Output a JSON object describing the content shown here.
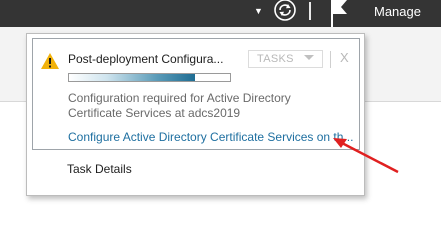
{
  "topbar": {
    "manage_label": "Manage",
    "icons": [
      "chevron-down-icon",
      "refresh-icon",
      "notification-flag-icon"
    ]
  },
  "notification": {
    "title": "Post-deployment Configura...",
    "tasks_label": "TASKS",
    "close_label": "X",
    "progress_fraction": 0.78,
    "message": "Configuration required for Active Directory Certificate Services at adcs2019",
    "link": "Configure Active Directory Certificate Services on th..."
  },
  "footer": {
    "task_details_label": "Task Details"
  },
  "colors": {
    "topbar": "#343434",
    "link": "#1e6fa0",
    "warning": "#f2b20a",
    "progress": "#1f6d93",
    "annotation_arrow": "#e02020"
  }
}
